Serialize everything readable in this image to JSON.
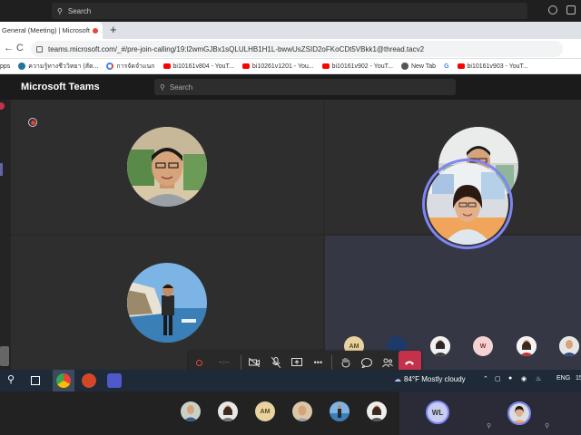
{
  "os": {
    "search_placeholder": "Search"
  },
  "browser": {
    "tab_title": "General (Meeting) | Microsoft",
    "tab_close": "×",
    "new_tab": "+",
    "url": "teams.microsoft.com/_#/pre-join-calling/19:l2wmGJBx1sQLULHB1H1L-bwwUsZSID2oFKoCDt5VBkk1@thread.tacv2",
    "back": "←",
    "reload": "C",
    "bookmarks": [
      {
        "label": "pps",
        "icon": "apps"
      },
      {
        "label": "ความรู้ทางชีววิทยา (สัต...",
        "icon": "wordpress-icon"
      },
      {
        "label": "การจัดจำแนก",
        "icon": "google-icon"
      },
      {
        "label": "bi10161v804 - YouT...",
        "icon": "youtube-icon"
      },
      {
        "label": "bi10261v1201 - You...",
        "icon": "youtube-icon"
      },
      {
        "label": "bi10161v902 - YouT...",
        "icon": "youtube-icon"
      },
      {
        "label": "New Tab",
        "icon": "globe-icon"
      },
      {
        "label": "G",
        "icon": "google-icon"
      },
      {
        "label": "bi10161v903 - YouT...",
        "icon": "youtube-icon"
      }
    ]
  },
  "teams": {
    "app_title": "Microsoft Teams",
    "search_placeholder": "Search"
  },
  "meeting": {
    "participants_strip": [
      {
        "initials": "AM"
      },
      {
        "initials": "W"
      }
    ],
    "controls": {
      "timer": "--:--",
      "hangup_label": "Leave"
    }
  },
  "taskbar": {
    "weather": "84°F  Mostly cloudy",
    "language": "ENG",
    "clock_partial": "15"
  },
  "second_screen": {
    "initials_am": "AM",
    "initials_wl": "WL"
  },
  "colors": {
    "teams_purple": "#7f85f5",
    "hangup_red": "#c4314b",
    "recording_red": "#e8453c"
  }
}
